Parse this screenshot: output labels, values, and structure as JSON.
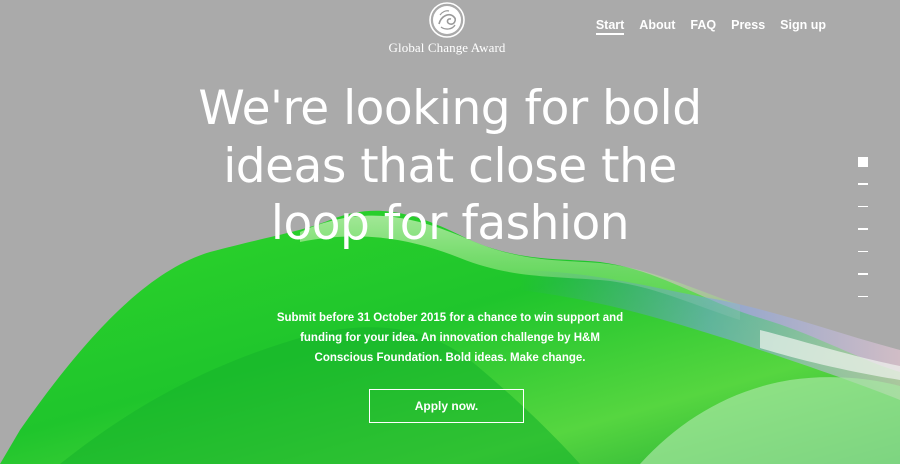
{
  "brand": {
    "name": "Global Change Award",
    "logo_icon": "swirl-seal-icon"
  },
  "nav": {
    "items": [
      {
        "label": "Start",
        "active": true
      },
      {
        "label": "About",
        "active": false
      },
      {
        "label": "FAQ",
        "active": false
      },
      {
        "label": "Press",
        "active": false
      },
      {
        "label": "Sign up",
        "active": false
      }
    ]
  },
  "hero": {
    "headline": "We're looking for bold ideas that close the loop for fashion",
    "subtext": "Submit before 31 October 2015 for a chance to win support and funding for your idea. An innovation challenge by H&M Conscious Foundation. Bold ideas. Make change.",
    "cta_label": "Apply now."
  },
  "section_nav": {
    "count": 7,
    "active_index": 0
  },
  "colors": {
    "background": "#aaaaaa",
    "paint_green": "#2fcf2f",
    "text": "#ffffff"
  }
}
